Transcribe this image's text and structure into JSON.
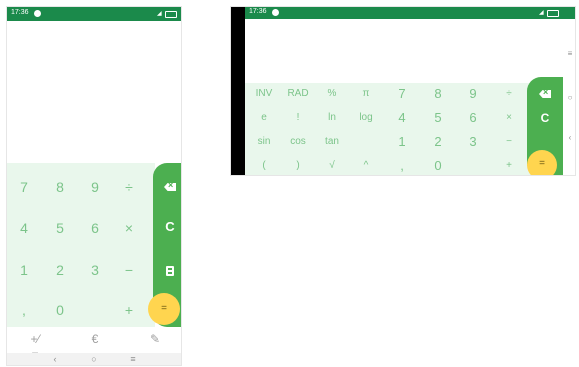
{
  "portrait": {
    "status": {
      "time": "17:36"
    },
    "keypad": {
      "row1": [
        "7",
        "8",
        "9",
        "÷"
      ],
      "row2": [
        "4",
        "5",
        "6",
        "×"
      ],
      "row3": [
        "1",
        "2",
        "3",
        "−"
      ],
      "row4": [
        ",",
        "0",
        "",
        "+"
      ]
    },
    "side": {
      "clear_label": "C",
      "equals_label": "="
    },
    "modes": [
      "+⁄−",
      "€",
      "✎"
    ],
    "nav": [
      "‹",
      "○",
      "≡"
    ]
  },
  "landscape": {
    "status": {
      "time": "17:36"
    },
    "keypad": {
      "row1": [
        "INV",
        "RAD",
        "%",
        "π",
        "7",
        "8",
        "9",
        "÷"
      ],
      "row2": [
        "e",
        "!",
        "ln",
        "log",
        "4",
        "5",
        "6",
        "×"
      ],
      "row3": [
        "sin",
        "cos",
        "tan",
        "",
        "1",
        "2",
        "3",
        "−"
      ],
      "row4": [
        "(",
        ")",
        "√",
        "^",
        ",",
        "0",
        "",
        "+"
      ]
    },
    "side": {
      "clear_label": "C",
      "equals_label": "="
    },
    "nav": [
      "≡",
      "○",
      "‹"
    ]
  },
  "colors": {
    "statusbar": "#1b8a4b",
    "keypad_bg": "#e9f7ec",
    "key_text": "#7cc48a",
    "side_bg": "#4caf50",
    "equals_bg": "#ffd54f"
  }
}
